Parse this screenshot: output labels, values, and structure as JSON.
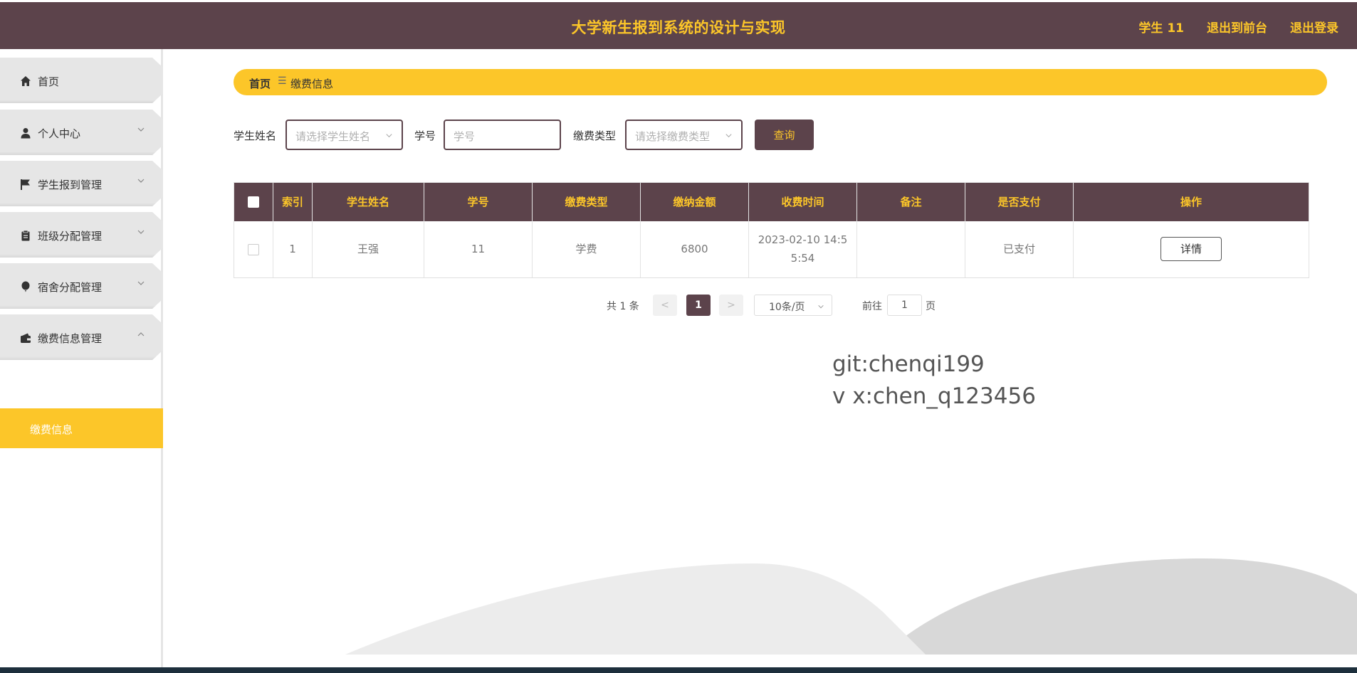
{
  "header": {
    "title": "大学新生报到系统的设计与实现",
    "user": "学生 11",
    "to_front": "退出到前台",
    "logout": "退出登录"
  },
  "sidebar": {
    "items": [
      {
        "label": "首页",
        "icon": "home-icon"
      },
      {
        "label": "个人中心",
        "icon": "user-icon"
      },
      {
        "label": "学生报到管理",
        "icon": "flag-icon"
      },
      {
        "label": "班级分配管理",
        "icon": "clipboard-icon"
      },
      {
        "label": "宿舍分配管理",
        "icon": "balloon-icon"
      },
      {
        "label": "缴费信息管理",
        "icon": "wallet-icon"
      }
    ],
    "active_sub": "缴费信息"
  },
  "breadcrumb": {
    "home": "首页",
    "separator": "☰",
    "current": "缴费信息"
  },
  "search": {
    "student_name_label": "学生姓名",
    "student_name_placeholder": "请选择学生姓名",
    "student_no_label": "学号",
    "student_no_placeholder": "学号",
    "fee_type_label": "缴费类型",
    "fee_type_placeholder": "请选择缴费类型",
    "query_button": "查询"
  },
  "table": {
    "columns": [
      "索引",
      "学生姓名",
      "学号",
      "缴费类型",
      "缴纳金额",
      "收费时间",
      "备注",
      "是否支付",
      "操作"
    ],
    "rows": [
      {
        "index": "1",
        "name": "王强",
        "student_no": "11",
        "fee_type": "学费",
        "amount": "6800",
        "time_line1": "2023-02-10 14:5",
        "time_line2": "5:54",
        "remark": "",
        "paid": "已支付",
        "action": "详情"
      }
    ]
  },
  "pagination": {
    "total": "共 1 条",
    "prev": "<",
    "current_page": "1",
    "next": ">",
    "page_size": "10条/页",
    "goto_label": "前往",
    "goto_value": "1",
    "page_unit": "页"
  },
  "watermark": {
    "line1": "git:chenqi199",
    "line2": "v x:chen_q123456"
  },
  "colors": {
    "primary": "#5c434b",
    "accent": "#fcc629",
    "menu_bg": "#e6e6e6"
  }
}
